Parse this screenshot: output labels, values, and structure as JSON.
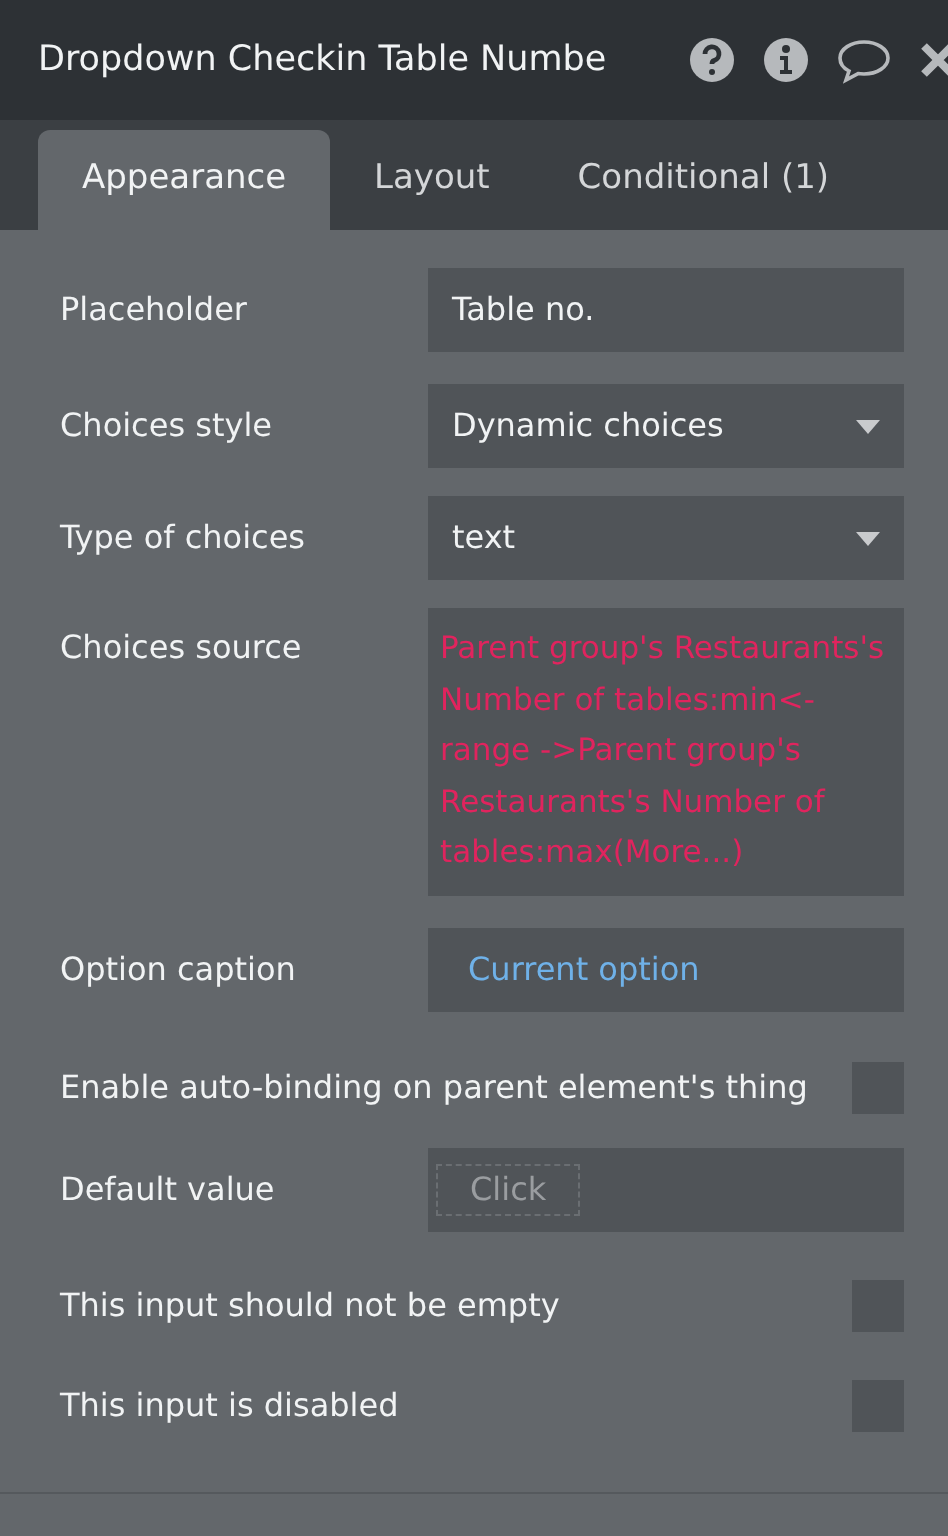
{
  "window": {
    "title": "Dropdown Checkin Table Numbe"
  },
  "tabs": [
    {
      "label": "Appearance",
      "selected": true
    },
    {
      "label": "Layout",
      "selected": false
    },
    {
      "label": "Conditional (1)",
      "selected": false
    }
  ],
  "properties": [
    {
      "kind": "text",
      "label": "Placeholder",
      "value": "Table no."
    },
    {
      "kind": "dropdown",
      "label": "Choices style",
      "value": "Dynamic choices"
    },
    {
      "kind": "dropdown",
      "label": "Type of choices",
      "value": "text"
    },
    {
      "kind": "expression",
      "label": "Choices source",
      "value": "Parent group's Restaurants's Number of tables:min<- range ->Parent group's Restaurants's Number of tables:max(More...)"
    },
    {
      "kind": "caption",
      "label": "Option caption",
      "value": "Current option"
    },
    {
      "kind": "checkbox",
      "label": "Enable auto-binding on parent element's thing",
      "checked": false
    },
    {
      "kind": "click",
      "label": "Default value",
      "value": "Click"
    },
    {
      "kind": "checkbox",
      "label": "This input should not be empty",
      "checked": false
    },
    {
      "kind": "checkbox",
      "label": "This input is disabled",
      "checked": false
    }
  ]
}
